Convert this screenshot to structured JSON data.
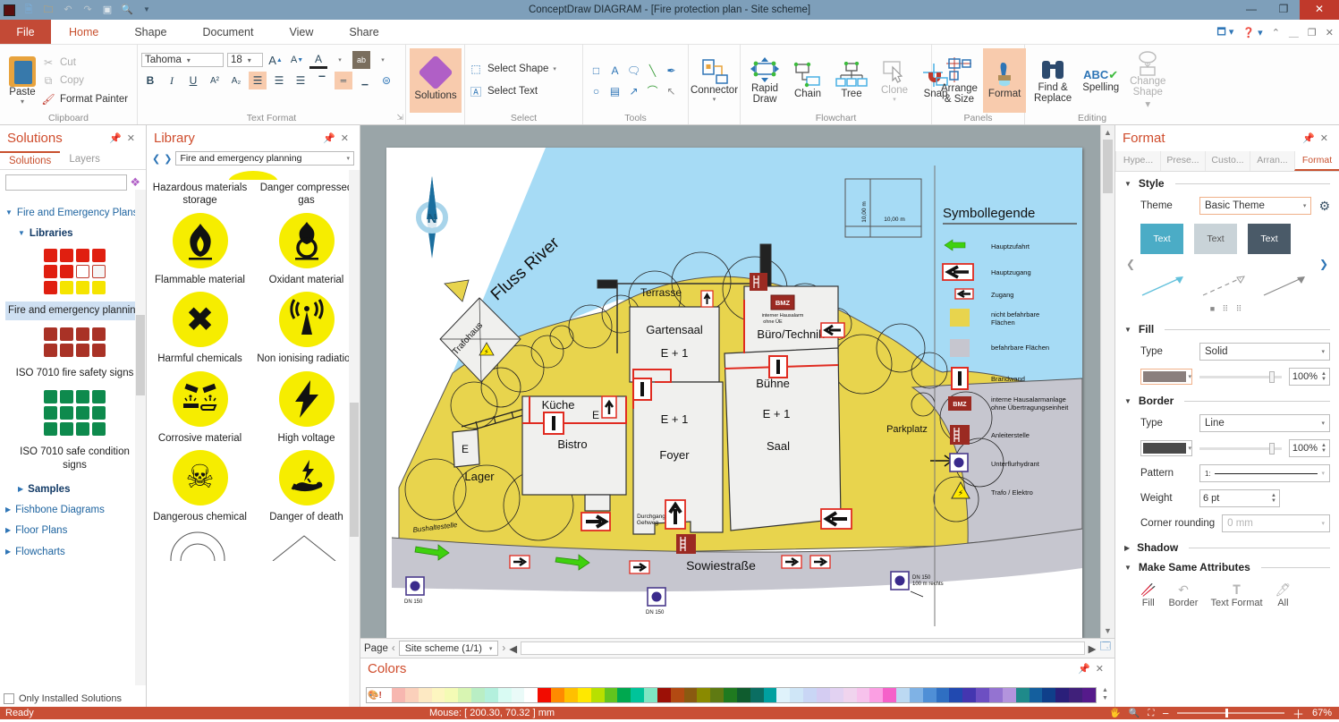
{
  "titlebar": {
    "title": "ConceptDraw DIAGRAM - [Fire protection plan - Site scheme]"
  },
  "menu": {
    "tabs": [
      "File",
      "Home",
      "Shape",
      "Document",
      "View",
      "Share"
    ]
  },
  "ribbon": {
    "clipboard": {
      "label": "Clipboard",
      "paste": "Paste",
      "cut": "Cut",
      "copy": "Copy",
      "format_painter": "Format Painter"
    },
    "text_format": {
      "label": "Text Format",
      "font": "Tahoma",
      "size": "18",
      "bold": "B",
      "italic": "I",
      "underline": "U"
    },
    "solutions_button": "Solutions",
    "select": {
      "label": "Select",
      "select_shape": "Select Shape",
      "select_text": "Select Text"
    },
    "tools": {
      "label": "Tools"
    },
    "connector": "Connector",
    "flowchart": {
      "label": "Flowchart",
      "rapid_draw": "Rapid Draw",
      "chain": "Chain",
      "tree": "Tree",
      "clone": "Clone",
      "snap": "Snap"
    },
    "panels": {
      "label": "Panels",
      "arrange": "Arrange & Size",
      "format": "Format"
    },
    "editing": {
      "label": "Editing",
      "find": "Find & Replace",
      "spelling": "Spelling",
      "change_shape": "Change Shape"
    }
  },
  "solutions_panel": {
    "title": "Solutions",
    "tabs": [
      "Solutions",
      "Layers"
    ],
    "tree_root": "Fire and Emergency Plans",
    "libraries": "Libraries",
    "lib1_name": "Fire and emergency planning",
    "lib2_name": "ISO 7010 fire safety signs",
    "lib3_name": "ISO 7010 safe condition signs",
    "samples": "Samples",
    "others": [
      "Fishbone Diagrams",
      "Floor Plans",
      "Flowcharts"
    ],
    "only_installed": "Only Installed Solutions",
    "grid1": [
      "#e01f10",
      "#e01f10",
      "#e01f10",
      "#e01f10",
      "#e01f10",
      "#e01f10",
      "#ffffff",
      "#f5f5f5",
      "#e01f10",
      "#f5e400",
      "#f5e400",
      "#f5e400"
    ],
    "grid2": [
      "#a93226",
      "#a93226",
      "#a93226",
      "#a93226",
      "#a93226",
      "#a93226",
      "#a93226",
      "#a93226"
    ],
    "grid3": [
      "#0e8a4d",
      "#0e8a4d",
      "#0e8a4d",
      "#0e8a4d",
      "#0e8a4d",
      "#0e8a4d",
      "#0e8a4d",
      "#0e8a4d",
      "#0e8a4d",
      "#0e8a4d",
      "#0e8a4d",
      "#0e8a4d"
    ]
  },
  "library_panel": {
    "title": "Library",
    "current_library": "Fire and emergency planning",
    "items": [
      {
        "label": "Hazardous materials storage"
      },
      {
        "label": "Danger compressed gas"
      },
      {
        "label": "Flammable material"
      },
      {
        "label": "Oxidant material"
      },
      {
        "label": "Harmful chemicals"
      },
      {
        "label": "Non ionising radiation"
      },
      {
        "label": "Corrosive material"
      },
      {
        "label": "High voltage"
      },
      {
        "label": "Dangerous chemical"
      },
      {
        "label": "Danger of death"
      }
    ]
  },
  "map": {
    "fluss_river": "Fluss River",
    "north": "N",
    "scale": "10,00 m",
    "terrasse": "Terrasse",
    "gartensaal": "Gartensaal",
    "e_plus_1": "E + 1",
    "buero": "Büro/Technik",
    "buehne": "Bühne",
    "saal": "Saal",
    "kueche": "Küche",
    "e": "E",
    "bistro": "Bistro",
    "lager": "Lager",
    "foyer": "Foyer",
    "durchgang": "Durchgang",
    "gehweg": "Gehweg",
    "bushaltestelle": "Bushaltestelle",
    "sowiestrasse": "Sowiestraße",
    "parkplatz": "Parkplatz",
    "trafohaus": "Trafohaus",
    "bmz": "BMZ",
    "hausalarm1": "interner Hausalarm",
    "hausalarm2": "ohne ÜE",
    "dn150": "DN 150",
    "m100": "100 m rechts"
  },
  "legend": {
    "title": "Symbollegende",
    "items": [
      {
        "label": "Hauptzufahrt",
        "label2": ""
      },
      {
        "label": "Hauptzugang",
        "label2": ""
      },
      {
        "label": "Zugang",
        "label2": ""
      },
      {
        "label": "nicht befahrbare",
        "label2": "Flächen"
      },
      {
        "label": "befahrbare Flächen",
        "label2": ""
      },
      {
        "label": "Brandwand",
        "label2": ""
      },
      {
        "label": "interne Hausalarmanlage",
        "label2": "ohne Übertragungseinheit"
      },
      {
        "label": "Anleiterstelle",
        "label2": ""
      },
      {
        "label": "Unterflurhydrant",
        "label2": ""
      },
      {
        "label": "Trafo / Elektro",
        "label2": ""
      }
    ]
  },
  "format_panel": {
    "title": "Format",
    "tabs": [
      "Hype...",
      "Prese...",
      "Custo...",
      "Arran...",
      "Format"
    ],
    "style": {
      "head": "Style",
      "theme_label": "Theme",
      "theme_value": "Basic Theme",
      "swatch_text": "Text"
    },
    "fill": {
      "head": "Fill",
      "type_label": "Type",
      "type_value": "Solid",
      "opacity": "100%",
      "color": "#8a7f7d"
    },
    "border": {
      "head": "Border",
      "type_label": "Type",
      "type_value": "Line",
      "opacity": "100%",
      "color": "#4a4a4a",
      "pattern_label": "Pattern",
      "pattern_value": "1:",
      "weight_label": "Weight",
      "weight_value": "6 pt",
      "corner_label": "Corner rounding",
      "corner_value": "0 mm"
    },
    "shadow": {
      "head": "Shadow"
    },
    "msa": {
      "head": "Make Same Attributes",
      "items": [
        "Fill",
        "Border",
        "Text Format",
        "All"
      ]
    }
  },
  "page_bar": {
    "page_label": "Page",
    "page_name": "Site scheme (1/1)"
  },
  "colors_panel": {
    "title": "Colors",
    "swatches": [
      "#f7b7b0",
      "#fbd0bb",
      "#fde9c3",
      "#fdf6c0",
      "#f4fbb5",
      "#d8f5b2",
      "#b9eec4",
      "#b3f0dd",
      "#d9fbf3",
      "#eafaf8",
      "#ffffff",
      "#f20c00",
      "#ff8a00",
      "#ffc000",
      "#ffe800",
      "#b8e000",
      "#62c41e",
      "#00a84f",
      "#00c49a",
      "#7fe6c3",
      "#9c1006",
      "#b34a12",
      "#8a5a10",
      "#8a8a00",
      "#5f7a12",
      "#1f7a1f",
      "#0f5c2e",
      "#0b6e62",
      "#00a0a0",
      "#dff2fb",
      "#cfe6f7",
      "#c9d6f5",
      "#d4ccf2",
      "#e2d2f2",
      "#f0d4ee",
      "#f7c2ec",
      "#fb9fe3",
      "#f561c9",
      "#bcd9f2",
      "#7fb2e5",
      "#4f8fd6",
      "#2f6fc2",
      "#2149b0",
      "#4436b0",
      "#6d4fc2",
      "#9473d1",
      "#b394dd",
      "#1f8a8a",
      "#145f9e",
      "#0f3f8a",
      "#2a1f7a",
      "#40207a",
      "#551a8b"
    ]
  },
  "status_bar": {
    "ready": "Ready",
    "mouse": "Mouse: [ 200.30, 70.32 ] mm",
    "zoom": "67%"
  },
  "theme_colors": {
    "accent": "#c8502e",
    "statusbar": "#c94f35",
    "site_yellow": "#e8d44d",
    "river_blue": "#a6dbf5",
    "road_gray": "#c6c6cf"
  }
}
